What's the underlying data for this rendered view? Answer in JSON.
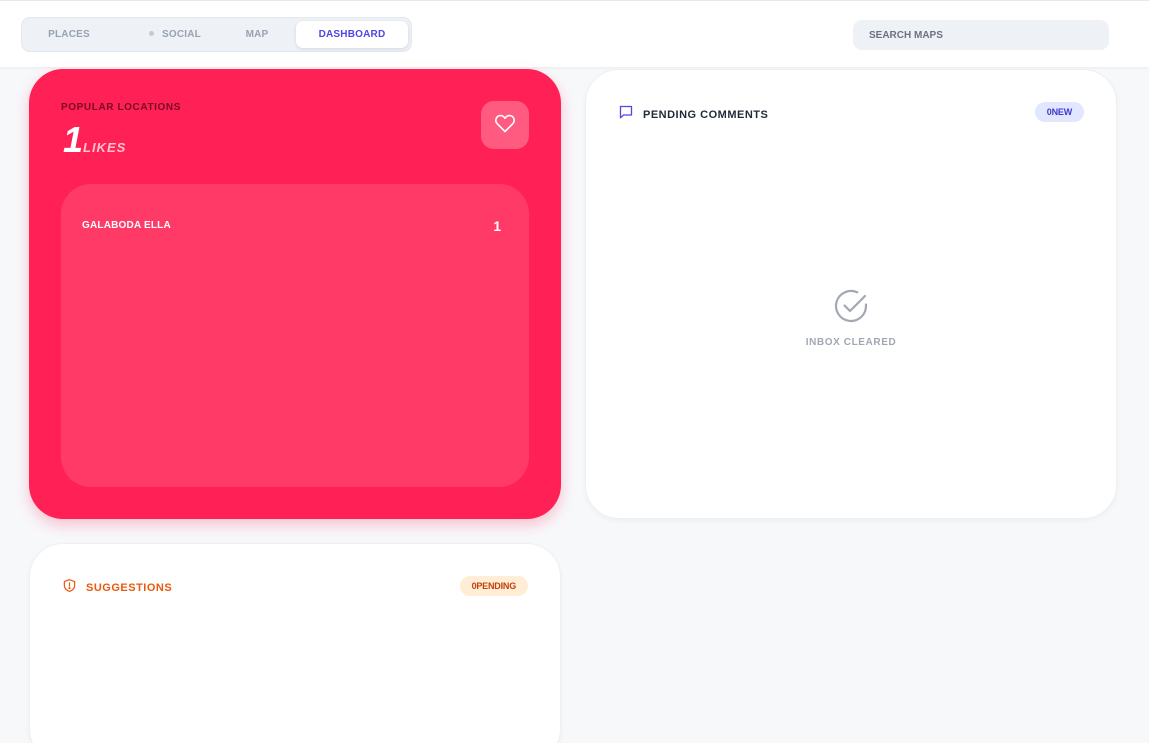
{
  "nav": {
    "tabs": [
      {
        "label": "PLACES"
      },
      {
        "label": "SOCIAL"
      },
      {
        "label": "MAP"
      },
      {
        "label": "DASHBOARD",
        "active": true
      }
    ]
  },
  "search": {
    "placeholder": "SEARCH MAPS"
  },
  "popular": {
    "label": "POPULAR LOCATIONS",
    "count": "1",
    "unit": "LIKES",
    "items": [
      {
        "name": "GALABODA ELLA",
        "count": "1"
      }
    ]
  },
  "comments": {
    "title": "PENDING COMMENTS",
    "badge": "0NEW",
    "empty_text": "INBOX CLEARED"
  },
  "suggestions": {
    "title": "SUGGESTIONS",
    "badge": "0PENDING"
  },
  "colors": {
    "accent": "#4f46e5",
    "popular_card": "#ff2156",
    "suggestions": "#ea580c"
  },
  "icons": [
    "heart-icon",
    "chat-bubble-icon",
    "check-circle-icon",
    "shield-icon"
  ]
}
